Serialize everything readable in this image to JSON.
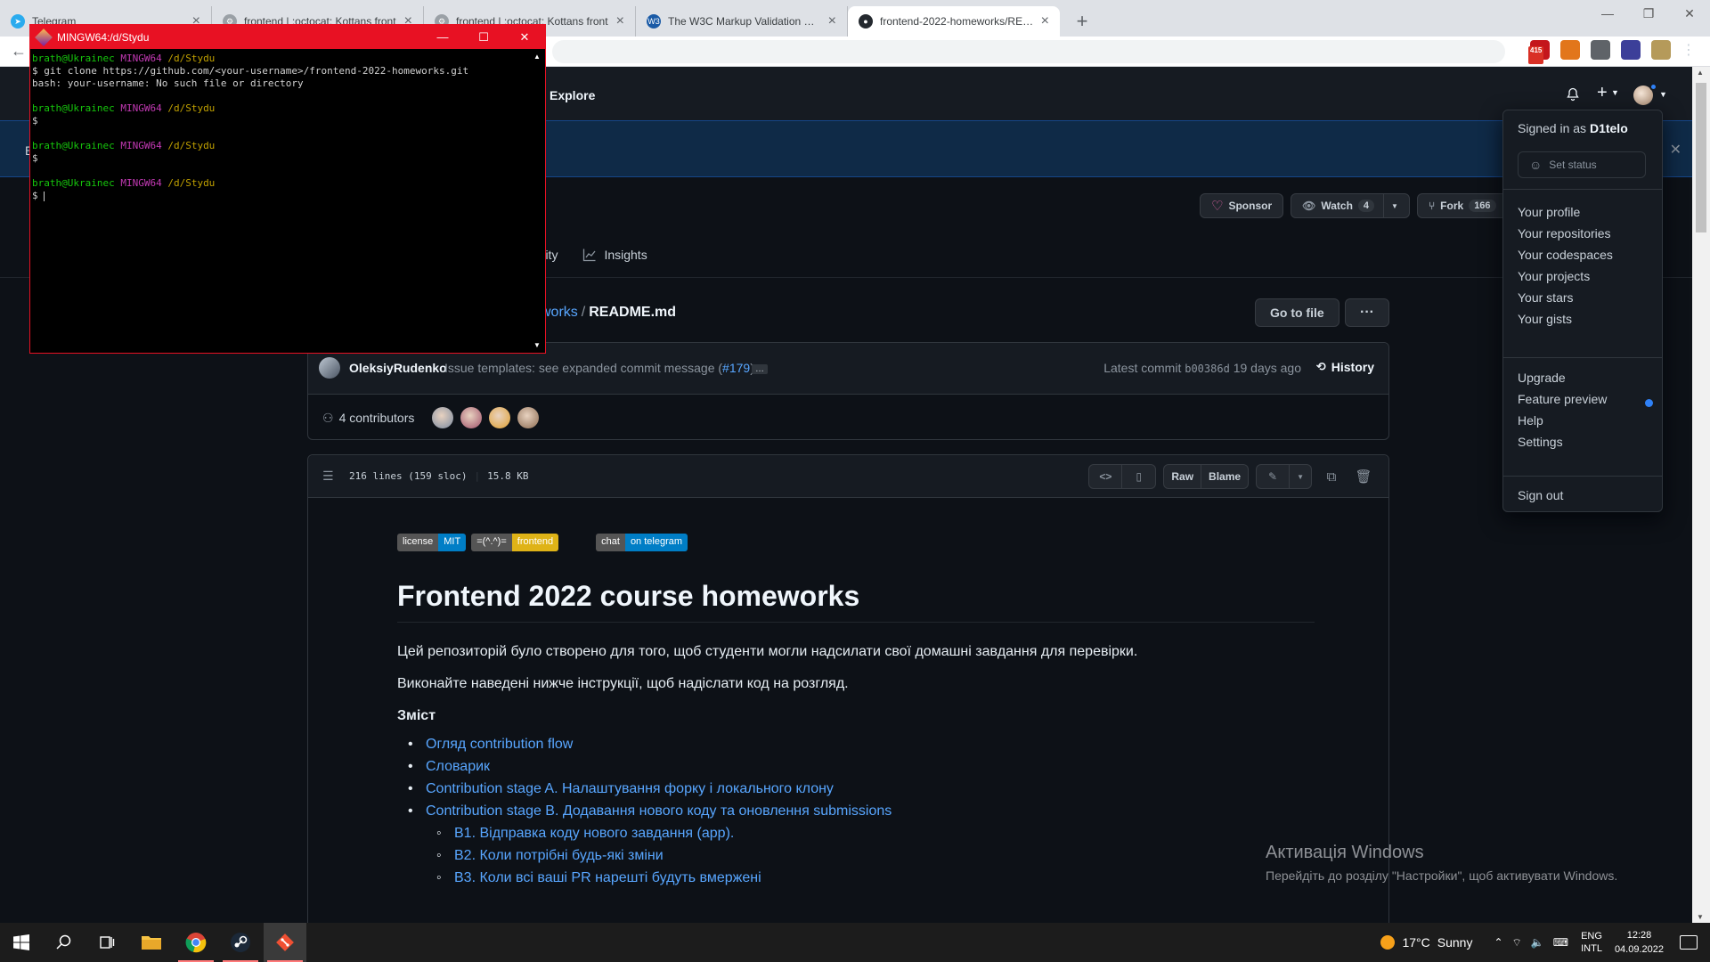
{
  "browser": {
    "tabs": [
      {
        "title": "Telegram",
        "favicon_color": "#2aabee",
        "favicon_glyph": "➤",
        "active": false
      },
      {
        "title": "frontend | :octocat: Kottans front",
        "favicon_color": "#9aa0a6",
        "favicon_glyph": "⚙",
        "active": false
      },
      {
        "title": "frontend | :octocat: Kottans front",
        "favicon_color": "#9aa0a6",
        "favicon_glyph": "⚙",
        "active": false
      },
      {
        "title": "The W3C Markup Validation Serv",
        "favicon_color": "#1a5aa6",
        "favicon_glyph": "W3",
        "active": false
      },
      {
        "title": "frontend-2022-homeworks/READ",
        "favicon_color": "#24292f",
        "favicon_glyph": "●",
        "active": true
      }
    ],
    "extensions": [
      {
        "name": "ublock-icon",
        "color": "#c4161c",
        "label": "",
        "badge": "415"
      },
      {
        "name": "metamask-icon",
        "color": "#e2761b",
        "label": ""
      },
      {
        "name": "globe-icon",
        "color": "#5f6368",
        "label": ""
      },
      {
        "name": "vpn-icon",
        "color": "#3c3f99",
        "label": ""
      },
      {
        "name": "profile-icon",
        "color": "#b59a5a",
        "label": ""
      }
    ],
    "menu_icon": "⋮"
  },
  "github": {
    "nav_explore": "Explore",
    "banner_initial": "E",
    "actions": {
      "sponsor": "Sponsor",
      "watch": "Watch",
      "watch_count": "4",
      "fork": "Fork",
      "fork_count": "166"
    },
    "repo_nav": {
      "partial": "urity",
      "insights": "Insights"
    },
    "breadcrumb": {
      "repo_partial": "works",
      "sep": "/",
      "file": "README.md"
    },
    "go_to_file": "Go to file",
    "more": "···",
    "commit": {
      "author": "OleksiyRudenko",
      "message": "Issue templates: see expanded commit message (",
      "pr": "#179",
      "message_end": ")",
      "ellipsis": "…",
      "latest_label": "Latest commit",
      "sha": "b00386d",
      "ago": "19 days ago",
      "history": "History",
      "contributors": "4 contributors"
    },
    "contributor_colors": [
      "#7a8aa0",
      "#a0506a",
      "#e0a030",
      "#8a6a50"
    ],
    "file": {
      "lines": "216 lines (159 sloc)",
      "size": "15.8 KB",
      "raw": "Raw",
      "blame": "Blame"
    },
    "readme": {
      "badges": [
        {
          "left": "license",
          "right": "MIT",
          "color": "#007ec6"
        },
        {
          "left": "=(^.^)=",
          "right": "frontend",
          "color": "#dfb317"
        }
      ],
      "badge_chat": {
        "left": "chat",
        "right": "on telegram",
        "color": "#007ec6"
      },
      "title": "Frontend 2022 course homeworks",
      "p1": "Цей репозиторій було створено для того, щоб студенти могли надсилати свої домашні завдання для перевірки.",
      "p2": "Виконайте наведені нижче інструкції, щоб надіслати код на розгляд.",
      "toc_heading": "Зміст",
      "toc": [
        "Огляд contribution flow",
        "Словарик",
        "Contribution stage A. Налаштування форку і локального клону",
        "Contribution stage B. Додавання нового коду та оновлення submissions"
      ],
      "toc_sub": [
        "B1. Відправка коду нового завдання (app).",
        "B2. Коли потрібні будь-які зміни",
        "B3. Коли всі ваші PR нарешті будуть вмержені"
      ]
    },
    "dropdown": {
      "signed_prefix": "Signed in as",
      "username": "D1telo",
      "set_status": "Set status",
      "group1": [
        "Your profile",
        "Your repositories",
        "Your codespaces",
        "Your projects",
        "Your stars",
        "Your gists"
      ],
      "group2": [
        "Upgrade",
        "Feature preview",
        "Help",
        "Settings"
      ],
      "sign_out": "Sign out"
    }
  },
  "terminal": {
    "title": "MINGW64:/d/Stydu",
    "user": "brath@Ukrainec",
    "env": "MINGW64",
    "path": "/d/Stydu",
    "command": "$ git clone https://github.com/<your-username>/frontend-2022-homeworks.git",
    "error": "bash: your-username: No such file or directory",
    "prompt": "$"
  },
  "windows": {
    "activate_title": "Активація Windows",
    "activate_sub": "Перейдіть до розділу \"Настройки\", щоб активувати Windows.",
    "weather_temp": "17°C",
    "weather_text": "Sunny",
    "lang1": "ENG",
    "lang2": "INTL",
    "time": "12:28",
    "date": "04.09.2022"
  }
}
